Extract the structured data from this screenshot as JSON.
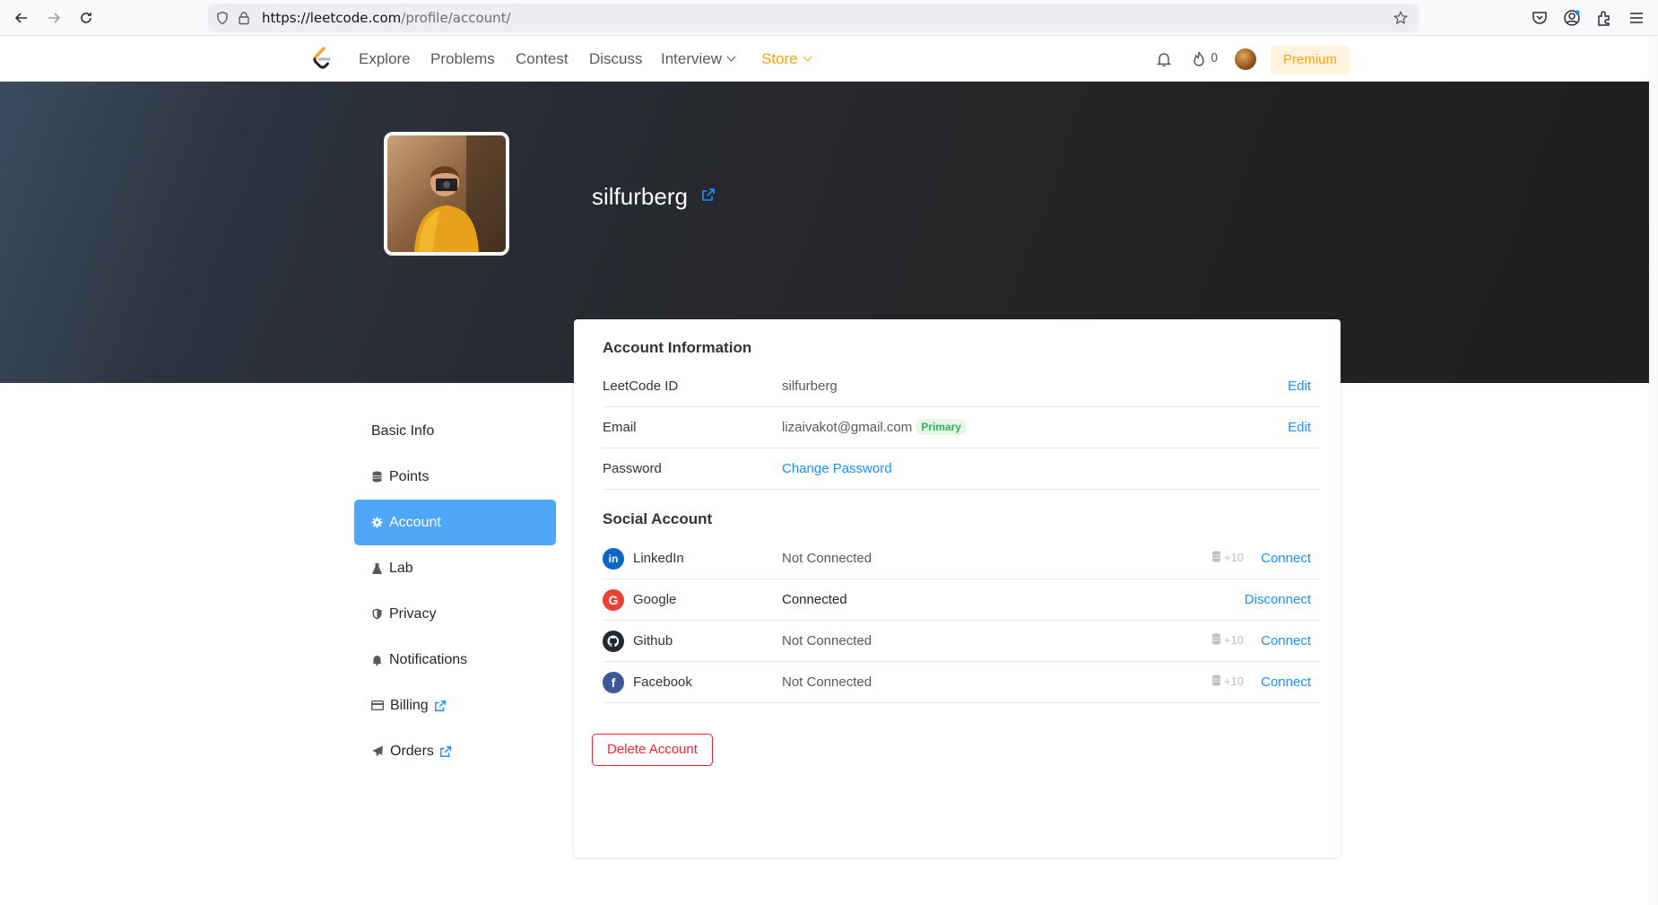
{
  "browser": {
    "url_host": "https://leetcode.com",
    "url_path": "/profile/account/"
  },
  "header": {
    "nav": [
      "Explore",
      "Problems",
      "Contest",
      "Discuss",
      "Interview",
      "Store"
    ],
    "streak_count": "0",
    "premium_label": "Premium"
  },
  "profile": {
    "username": "silfurberg"
  },
  "sidebar": {
    "items": [
      {
        "label": "Basic Info",
        "icon": "none"
      },
      {
        "label": "Points",
        "icon": "coins-icon"
      },
      {
        "label": "Account",
        "icon": "gear-icon",
        "active": true
      },
      {
        "label": "Lab",
        "icon": "flask-icon"
      },
      {
        "label": "Privacy",
        "icon": "shield-icon"
      },
      {
        "label": "Notifications",
        "icon": "bell-icon"
      },
      {
        "label": "Billing",
        "icon": "credit-card-icon",
        "external": true
      },
      {
        "label": "Orders",
        "icon": "paper-plane-icon",
        "external": true
      }
    ]
  },
  "account_info": {
    "title": "Account Information",
    "rows": [
      {
        "label": "LeetCode ID",
        "value": "silfurberg",
        "action": "Edit"
      },
      {
        "label": "Email",
        "value": "lizaivakot@gmail.com",
        "badge": "Primary",
        "action": "Edit"
      },
      {
        "label": "Password",
        "value": "Change Password"
      }
    ]
  },
  "social": {
    "title": "Social Account",
    "rows": [
      {
        "label": "LinkedIn",
        "status": "Not Connected",
        "bonus": "+10",
        "action": "Connect",
        "color": "#0a66c2"
      },
      {
        "label": "Google",
        "status": "Connected",
        "action": "Disconnect",
        "color": "#ea4335"
      },
      {
        "label": "Github",
        "status": "Not Connected",
        "bonus": "+10",
        "action": "Connect",
        "color": "#24292e"
      },
      {
        "label": "Facebook",
        "status": "Not Connected",
        "bonus": "+10",
        "action": "Connect",
        "color": "#3b5998"
      }
    ]
  },
  "delete_label": "Delete Account",
  "colors": {
    "brand_orange": "#ffa116",
    "link_blue": "#1a90ff",
    "active_blue": "#4fa7f7",
    "danger_red": "#f5222d"
  }
}
